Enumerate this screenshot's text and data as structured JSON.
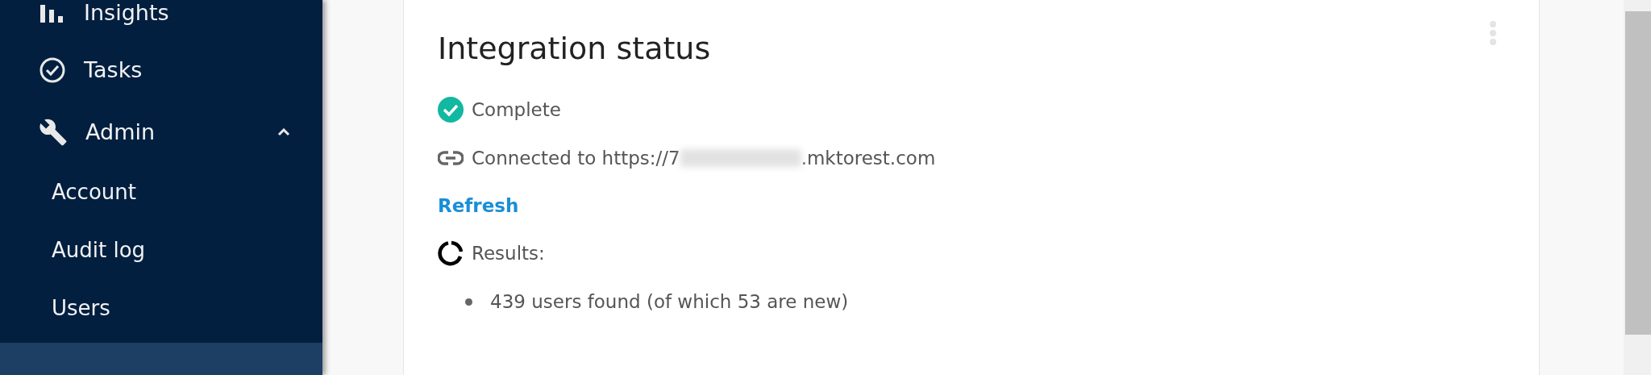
{
  "sidebar": {
    "items": [
      {
        "label": "Insights"
      },
      {
        "label": "Tasks"
      },
      {
        "label": "Admin",
        "expanded": true,
        "children": [
          {
            "label": "Account"
          },
          {
            "label": "Audit log"
          },
          {
            "label": "Users"
          }
        ]
      }
    ]
  },
  "card": {
    "title": "Integration status",
    "status": "Complete",
    "connection": {
      "prefix": "Connected to https://7",
      "suffix": ".mktorest.com"
    },
    "refresh_link": "Refresh",
    "results": {
      "label": "Results:",
      "items": [
        "439 users found (of which 53 are new)"
      ]
    }
  }
}
